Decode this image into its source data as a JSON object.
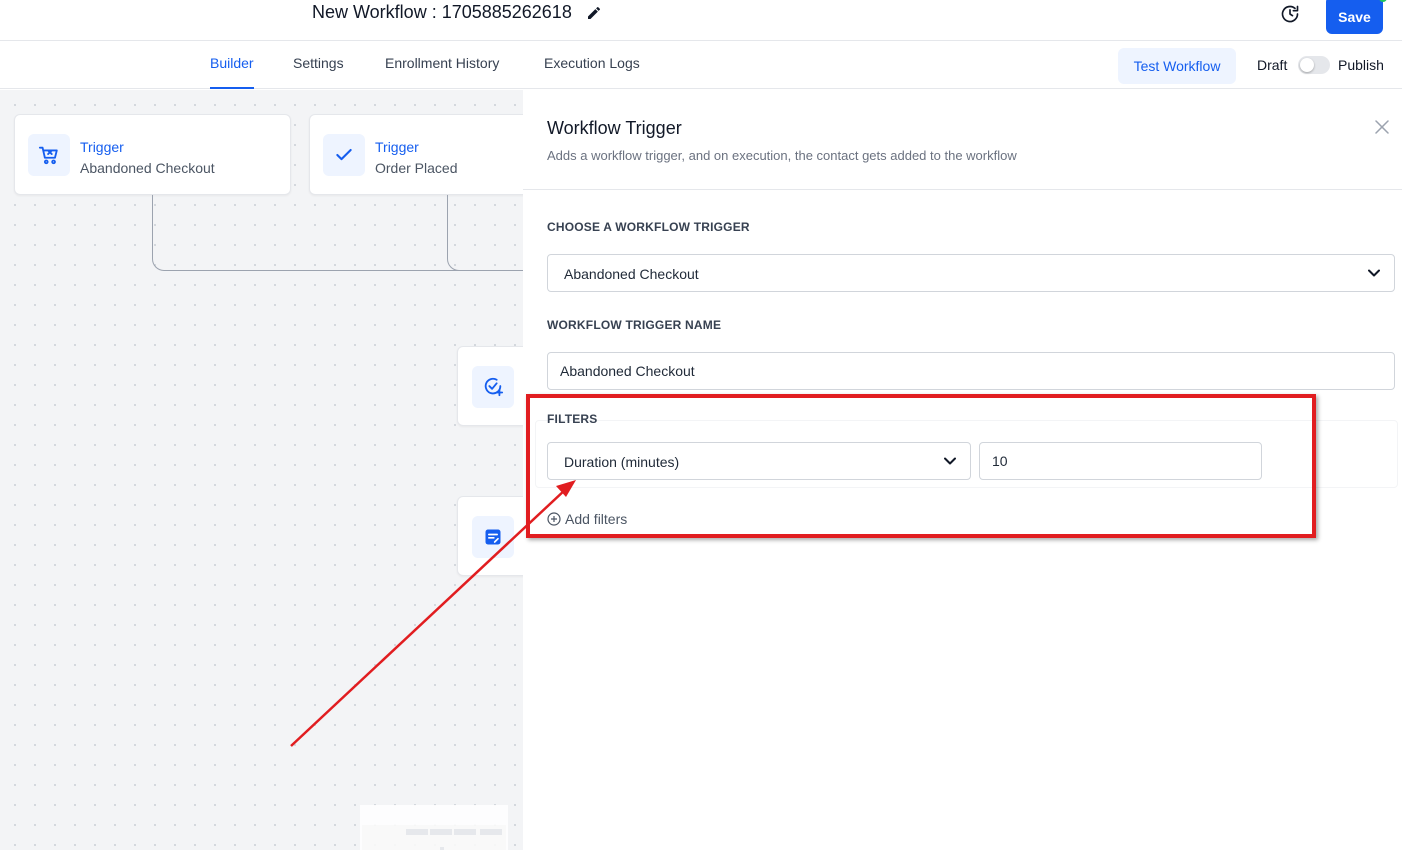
{
  "header": {
    "workflow_title": "New Workflow : 1705885262618",
    "save_label": "Save"
  },
  "tabs": [
    {
      "label": "Builder",
      "active": true
    },
    {
      "label": "Settings",
      "active": false
    },
    {
      "label": "Enrollment History",
      "active": false
    },
    {
      "label": "Execution Logs",
      "active": false
    }
  ],
  "toolbar": {
    "test_workflow_label": "Test Workflow",
    "draft_label": "Draft",
    "publish_label": "Publish",
    "published": false
  },
  "canvas": {
    "nodes": [
      {
        "type": "Trigger",
        "name": "Abandoned Checkout",
        "icon": "cart-icon"
      },
      {
        "type": "Trigger",
        "name": "Order Placed",
        "icon": "check-icon"
      }
    ],
    "action_node_icons": [
      "add-task-icon",
      "note-icon"
    ]
  },
  "panel": {
    "title": "Workflow Trigger",
    "description": "Adds a workflow trigger, and on execution, the contact gets added to the workflow",
    "choose_trigger_label": "CHOOSE A WORKFLOW TRIGGER",
    "selected_trigger": "Abandoned Checkout",
    "trigger_name_label": "WORKFLOW TRIGGER NAME",
    "trigger_name_value": "Abandoned Checkout",
    "filters_label": "FILTERS",
    "filter_field": "Duration (minutes)",
    "filter_value": "10",
    "add_filters_label": "Add filters"
  },
  "colors": {
    "primary": "#155eef",
    "annotation": "#e11d20"
  }
}
